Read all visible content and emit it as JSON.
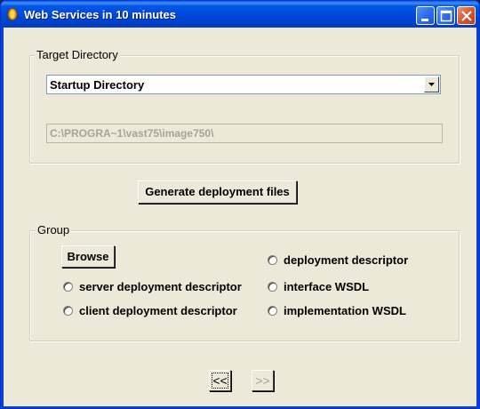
{
  "window": {
    "title": "Web Services in 10 minutes"
  },
  "titlebar_buttons": {
    "minimize_icon": "minimize-icon",
    "maximize_icon": "maximize-icon",
    "close_icon": "close-icon"
  },
  "target_directory": {
    "legend": "Target Directory",
    "select_value": "Startup Directory",
    "path": "C:\\PROGRA~1\\vast75\\image750\\"
  },
  "generate_button": "Generate deployment files",
  "group": {
    "legend": "Group",
    "browse": "Browse",
    "options": [
      "server deployment descriptor",
      "client deployment descriptor",
      "deployment descriptor",
      "interface WSDL",
      "implementation WSDL"
    ]
  },
  "nav": {
    "prev": "<<",
    "next": ">>"
  },
  "colors": {
    "titlebar": "#0055e5",
    "window_bg": "#ece9d8",
    "disabled_text": "#a6a497"
  }
}
